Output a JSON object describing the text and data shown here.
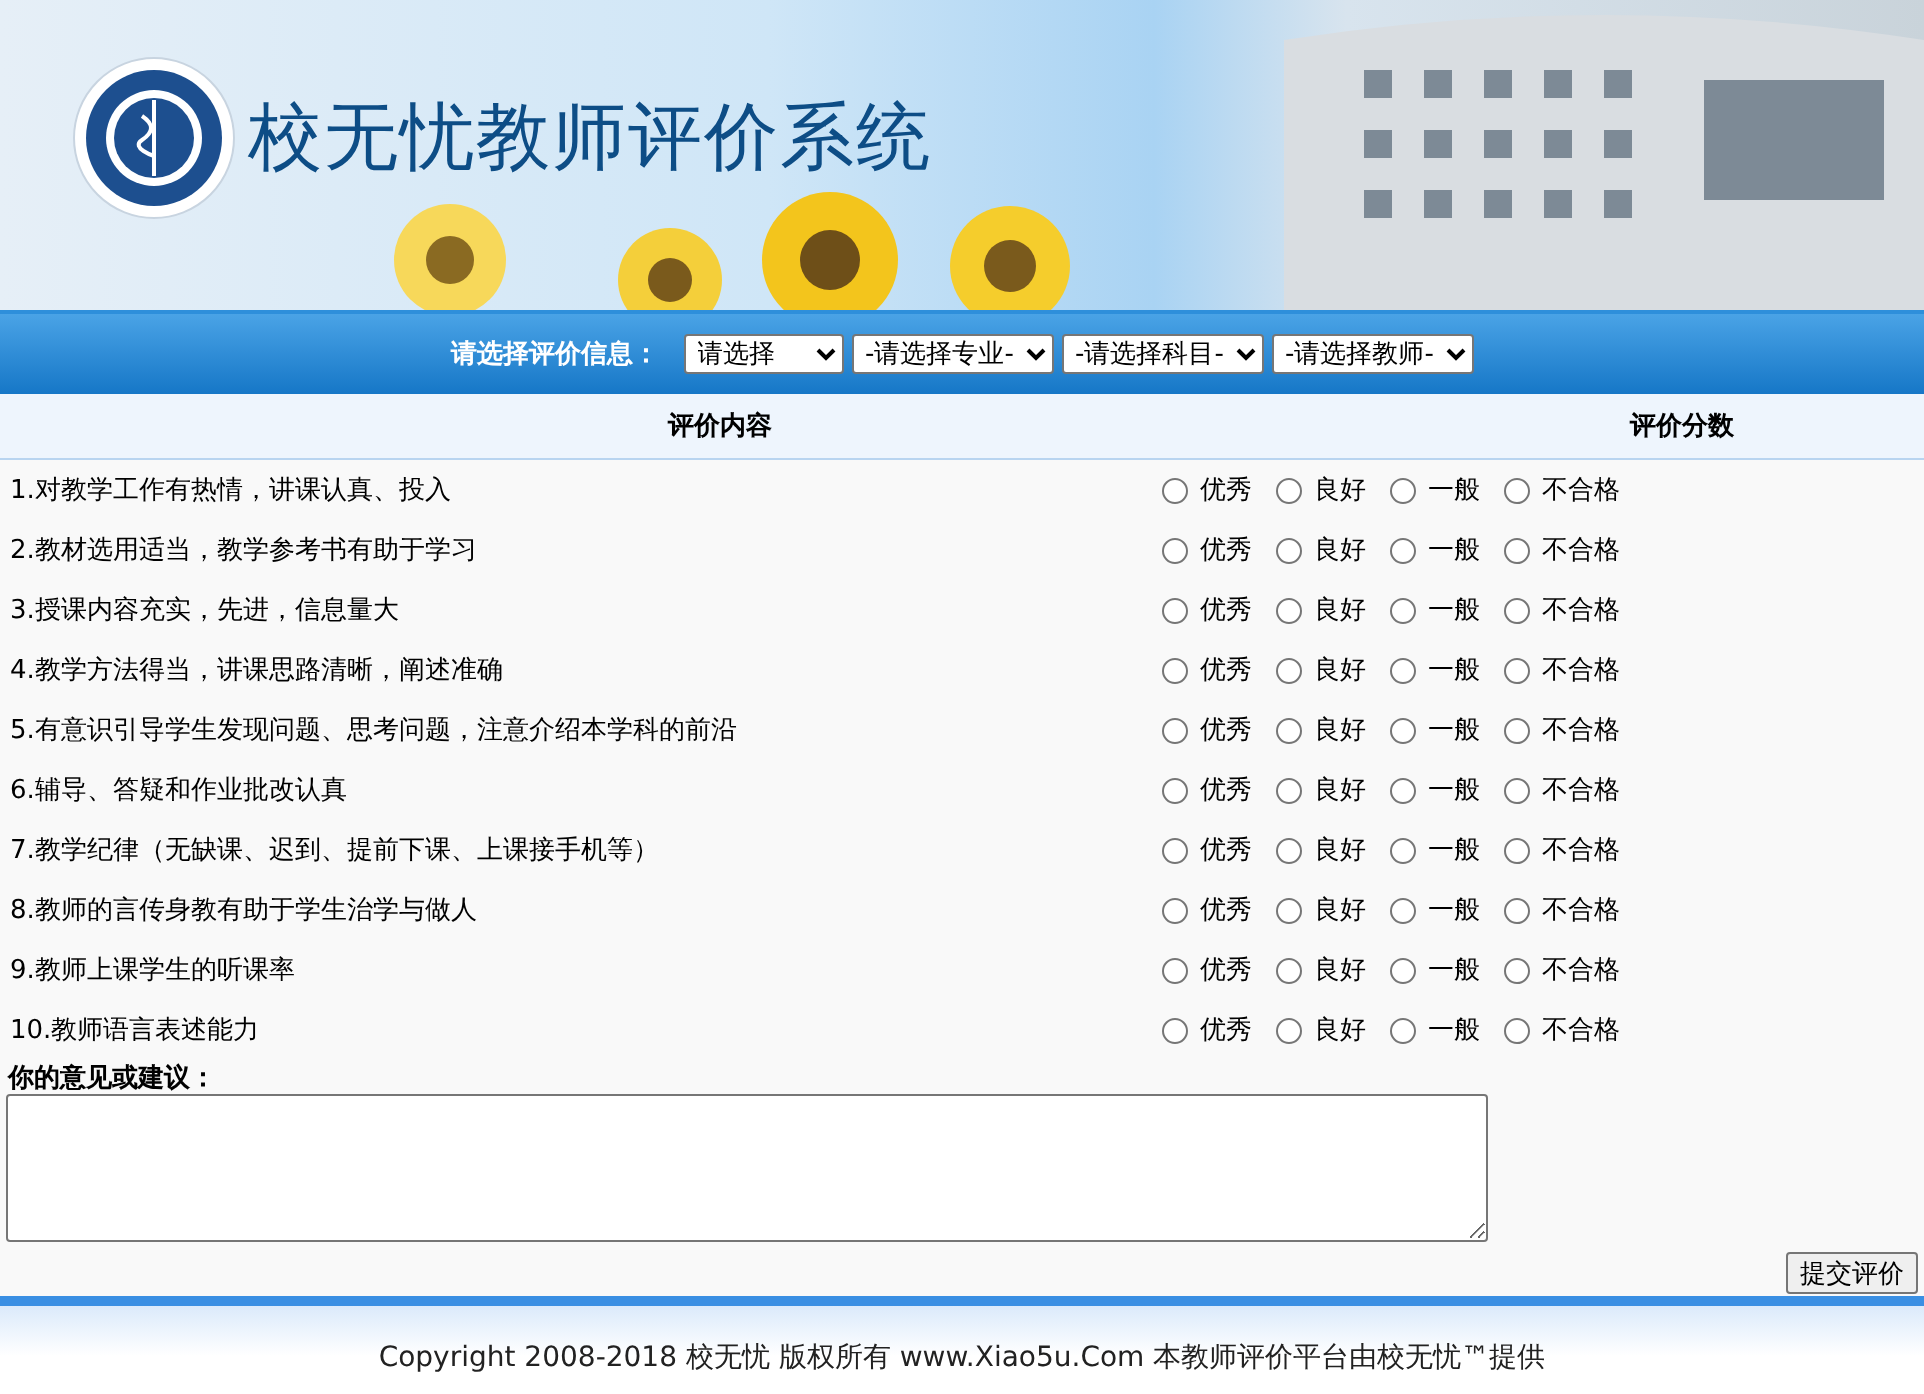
{
  "header": {
    "title": "校无忧教师评价系统"
  },
  "filter_bar": {
    "label": "请选择评价信息：",
    "selects": [
      {
        "value": "请选择"
      },
      {
        "value": "-请选择专业-"
      },
      {
        "value": "-请选择科目-"
      },
      {
        "value": "-请选择教师-"
      }
    ]
  },
  "table": {
    "columns": [
      "评价内容",
      "评价分数"
    ],
    "rows": [
      {
        "item": "1.对教学工作有热情，讲课认真、投入",
        "options": [
          {
            "label": "优秀",
            "selected": false
          },
          {
            "label": "良好",
            "selected": false
          },
          {
            "label": "一般",
            "selected": false
          },
          {
            "label": "不合格",
            "selected": false
          }
        ]
      },
      {
        "item": "2.教材选用适当，教学参考书有助于学习",
        "options": [
          {
            "label": "优秀",
            "selected": false
          },
          {
            "label": "良好",
            "selected": false
          },
          {
            "label": "一般",
            "selected": false
          },
          {
            "label": "不合格",
            "selected": false
          }
        ]
      },
      {
        "item": "3.授课内容充实，先进，信息量大",
        "options": [
          {
            "label": "优秀",
            "selected": false
          },
          {
            "label": "良好",
            "selected": false
          },
          {
            "label": "一般",
            "selected": false
          },
          {
            "label": "不合格",
            "selected": false
          }
        ]
      },
      {
        "item": "4.教学方法得当，讲课思路清晰，阐述准确",
        "options": [
          {
            "label": "优秀",
            "selected": false
          },
          {
            "label": "良好",
            "selected": false
          },
          {
            "label": "一般",
            "selected": false
          },
          {
            "label": "不合格",
            "selected": false
          }
        ]
      },
      {
        "item": "5.有意识引导学生发现问题、思考问题，注意介绍本学科的前沿",
        "options": [
          {
            "label": "优秀",
            "selected": false
          },
          {
            "label": "良好",
            "selected": false
          },
          {
            "label": "一般",
            "selected": false
          },
          {
            "label": "不合格",
            "selected": false
          }
        ]
      },
      {
        "item": "6.辅导、答疑和作业批改认真",
        "options": [
          {
            "label": "优秀",
            "selected": false
          },
          {
            "label": "良好",
            "selected": false
          },
          {
            "label": "一般",
            "selected": false
          },
          {
            "label": "不合格",
            "selected": false
          }
        ]
      },
      {
        "item": "7.教学纪律（无缺课、迟到、提前下课、上课接手机等）",
        "options": [
          {
            "label": "优秀",
            "selected": false
          },
          {
            "label": "良好",
            "selected": false
          },
          {
            "label": "一般",
            "selected": false
          },
          {
            "label": "不合格",
            "selected": false
          }
        ]
      },
      {
        "item": "8.教师的言传身教有助于学生治学与做人",
        "options": [
          {
            "label": "优秀",
            "selected": false
          },
          {
            "label": "良好",
            "selected": false
          },
          {
            "label": "一般",
            "selected": false
          },
          {
            "label": "不合格",
            "selected": false
          }
        ]
      },
      {
        "item": "9.教师上课学生的听课率",
        "options": [
          {
            "label": "优秀",
            "selected": false
          },
          {
            "label": "良好",
            "selected": false
          },
          {
            "label": "一般",
            "selected": false
          },
          {
            "label": "不合格",
            "selected": false
          }
        ]
      },
      {
        "item": "10.教师语言表述能力",
        "options": [
          {
            "label": "优秀",
            "selected": false
          },
          {
            "label": "良好",
            "selected": false
          },
          {
            "label": "一般",
            "selected": false
          },
          {
            "label": "不合格",
            "selected": false
          }
        ]
      }
    ]
  },
  "comments": {
    "label": "你的意见或建议："
  },
  "submit_button": "提交评价",
  "footer": {
    "copyright": "Copyright 2008-2018 校无忧 版权所有 www.Xiao5u.Com 本教师评价平台由校无忧™提供"
  }
}
